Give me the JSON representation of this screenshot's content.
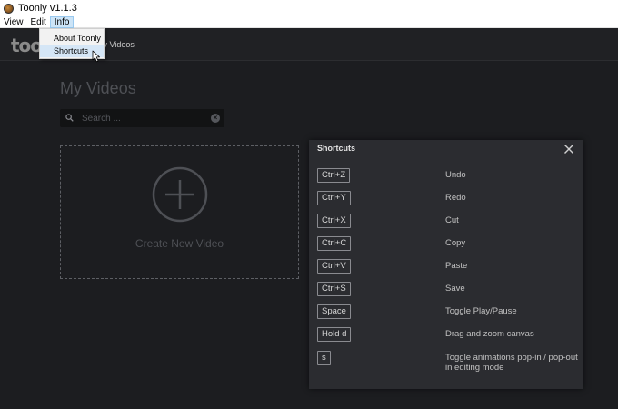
{
  "window": {
    "title": "Toonly v1.1.3"
  },
  "menubar": {
    "items": [
      "View",
      "Edit",
      "Info"
    ]
  },
  "info_menu": {
    "items": [
      "About Toonly",
      "Shortcuts"
    ]
  },
  "appbar": {
    "logo_text": "toonly",
    "nav_tab": "My Videos"
  },
  "main": {
    "page_title": "My Videos",
    "search": {
      "placeholder": "Search ..."
    },
    "create_label": "Create New Video"
  },
  "shortcuts": {
    "title": "Shortcuts",
    "rows": [
      {
        "key": "Ctrl+Z",
        "desc": "Undo"
      },
      {
        "key": "Ctrl+Y",
        "desc": "Redo"
      },
      {
        "key": "Ctrl+X",
        "desc": "Cut"
      },
      {
        "key": "Ctrl+C",
        "desc": "Copy"
      },
      {
        "key": "Ctrl+V",
        "desc": "Paste"
      },
      {
        "key": "Ctrl+S",
        "desc": "Save"
      },
      {
        "key": "Space",
        "desc": "Toggle Play/Pause"
      },
      {
        "key": "Hold d",
        "desc": "Drag and zoom canvas"
      },
      {
        "key": "s",
        "desc": "Toggle animations pop-in / pop-out in editing mode"
      }
    ]
  }
}
